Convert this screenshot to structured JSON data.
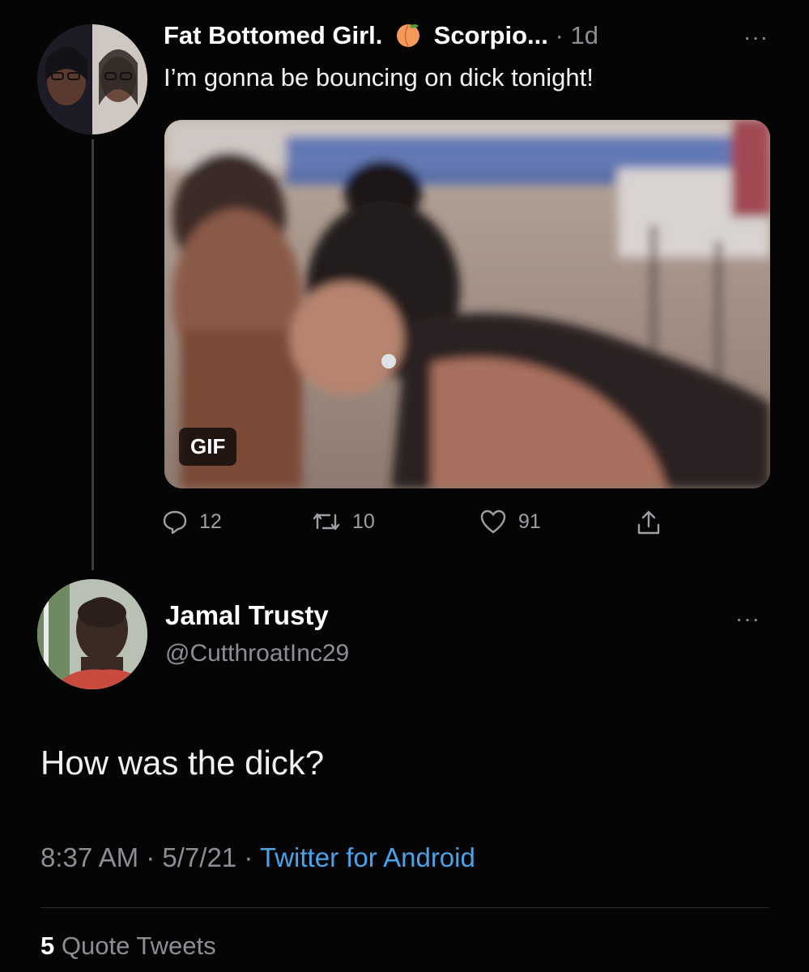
{
  "tweet1": {
    "display_name": "Fat Bottomed Girl.",
    "name_suffix": "Scorpio...",
    "time": "· 1d",
    "more": "···",
    "text": "I’m gonna be bouncing on dick tonight!",
    "media_badge": "GIF",
    "actions": {
      "replies": "12",
      "retweets": "10",
      "likes": "91"
    }
  },
  "tweet2": {
    "display_name": "Jamal Trusty",
    "handle": "@CutthroatInc29",
    "more": "···",
    "text": "How was the dick?",
    "timestamp": "8:37 AM · 5/7/21 · ",
    "source": "Twitter for Android",
    "quote_count": "5",
    "quote_label": "Quote Tweets"
  },
  "icons": {
    "peach": "peach-emoji-icon",
    "reply": "reply-icon",
    "retweet": "retweet-icon",
    "like": "heart-icon",
    "share": "share-icon",
    "more": "more-icon"
  },
  "colors": {
    "background": "#050506",
    "text": "#e7e9ea",
    "muted": "#8b8f94",
    "link": "#4aa3e8"
  }
}
